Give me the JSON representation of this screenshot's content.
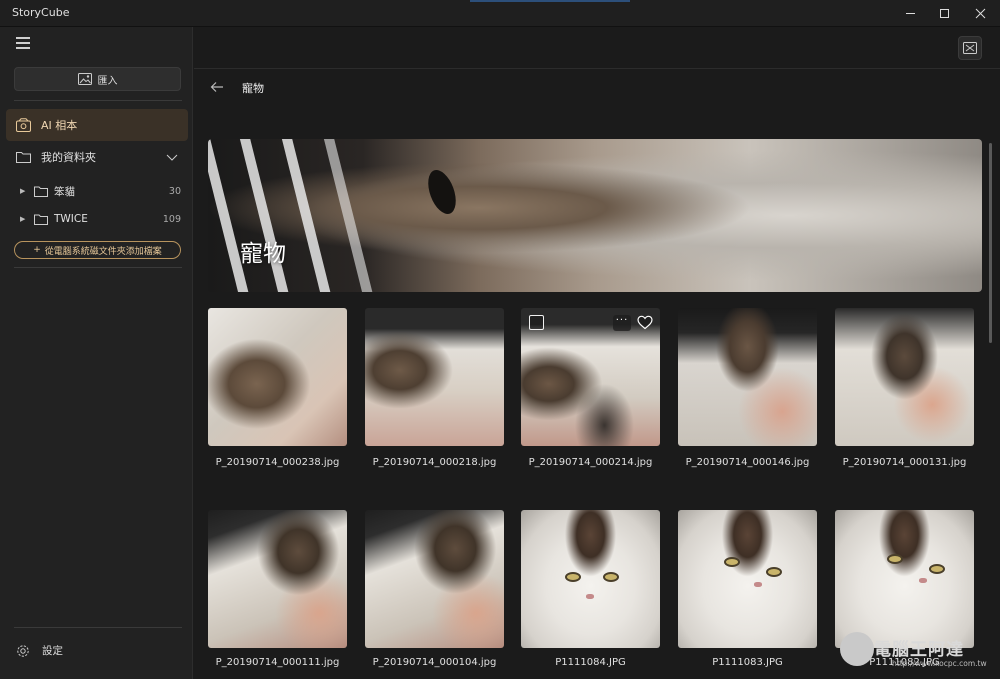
{
  "app": {
    "title": "StoryCube"
  },
  "sidebar": {
    "import_label": "匯入",
    "ai_album_label": "AI 相本",
    "my_folders_label": "我的資料夾",
    "folders": [
      {
        "name": "笨貓",
        "count": "30"
      },
      {
        "name": "TWICE",
        "count": "109"
      }
    ],
    "add_folder_label": "從電腦系統磁文件夾添加檔案",
    "settings_label": "設定"
  },
  "main": {
    "page_title": "寵物",
    "banner_title": "寵物",
    "photos": [
      {
        "filename": "P_20190714_000238.jpg"
      },
      {
        "filename": "P_20190714_000218.jpg"
      },
      {
        "filename": "P_20190714_000214.jpg"
      },
      {
        "filename": "P_20190714_000146.jpg"
      },
      {
        "filename": "P_20190714_000131.jpg"
      },
      {
        "filename": "P_20190714_000111.jpg"
      },
      {
        "filename": "P_20190714_000104.jpg"
      },
      {
        "filename": "P1111084.JPG"
      },
      {
        "filename": "P1111083.JPG"
      },
      {
        "filename": "P1111082.JPG"
      }
    ]
  },
  "watermark": {
    "text": "電腦王阿達",
    "url": "http://www.kocpc.com.tw"
  },
  "colors": {
    "accent": "#b8945e",
    "selected_bg": "#3a3127",
    "selected_text": "#f0d7b3"
  }
}
